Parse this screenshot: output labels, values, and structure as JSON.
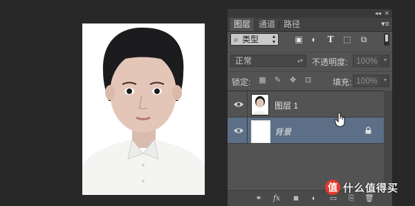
{
  "canvas": {
    "photo_alt": "portrait photo"
  },
  "panel": {
    "tabs": [
      "图层",
      "通道",
      "路径"
    ],
    "filter": {
      "label": "类型"
    },
    "blend": {
      "mode": "正常",
      "opacity_label": "不透明度:",
      "opacity_value": "100%"
    },
    "lock": {
      "label": "锁定:",
      "fill_label": "填充:",
      "fill_value": "100%"
    },
    "layers": [
      {
        "name": "图层 1",
        "visible": true,
        "selected": false,
        "locked": false
      },
      {
        "name": "背景",
        "visible": true,
        "selected": true,
        "locked": true
      }
    ],
    "bottom_icons": [
      "link-icon",
      "fx-icon",
      "mask-icon",
      "adjustment-icon",
      "folder-icon",
      "new-layer-icon",
      "trash-icon"
    ],
    "selection_color": "#5c6f86"
  },
  "watermark": {
    "text": "什么值得买",
    "logo": "值"
  }
}
